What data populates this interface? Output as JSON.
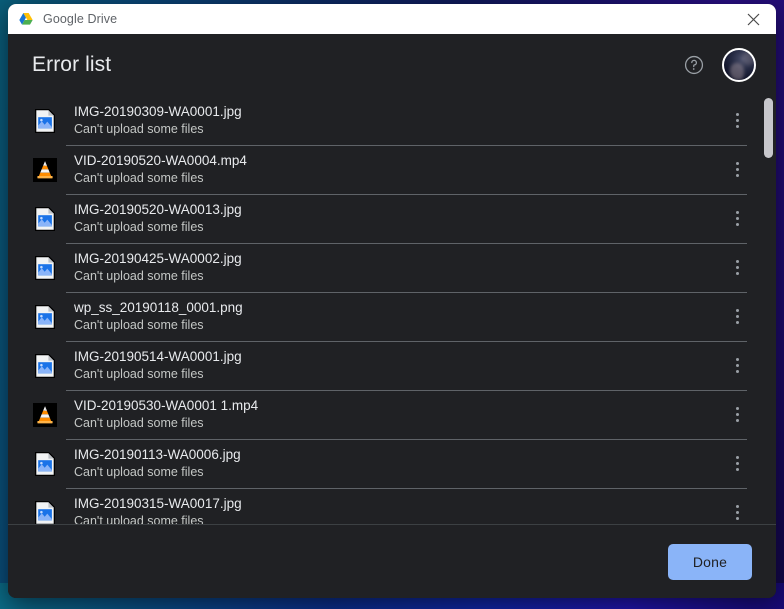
{
  "titlebar": {
    "title": "Google Drive",
    "app_icon": "google-drive-logo",
    "close_icon": "close-icon"
  },
  "header": {
    "title": "Error list",
    "help_icon": "help-circle-icon",
    "avatar_icon": "user-avatar"
  },
  "colors": {
    "window_bg": "#202124",
    "titlebar_bg": "#ffffff",
    "accent": "#8ab4f8",
    "primary_text": "#e8eaed",
    "secondary_text": "#c4c7c5",
    "divider": "#5f6368",
    "scrollbar_thumb": "#c7c7cc"
  },
  "list": {
    "menu_icon": "more-vertical-icon",
    "items": [
      {
        "name": "IMG-20190309-WA0001.jpg",
        "status": "Can't upload some files",
        "icon": "image-file-icon"
      },
      {
        "name": "VID-20190520-WA0004.mp4",
        "status": "Can't upload some files",
        "icon": "vlc-video-file-icon"
      },
      {
        "name": "IMG-20190520-WA0013.jpg",
        "status": "Can't upload some files",
        "icon": "image-file-icon"
      },
      {
        "name": "IMG-20190425-WA0002.jpg",
        "status": "Can't upload some files",
        "icon": "image-file-icon"
      },
      {
        "name": "wp_ss_20190118_0001.png",
        "status": "Can't upload some files",
        "icon": "image-file-icon"
      },
      {
        "name": "IMG-20190514-WA0001.jpg",
        "status": "Can't upload some files",
        "icon": "image-file-icon"
      },
      {
        "name": "VID-20190530-WA0001 1.mp4",
        "status": "Can't upload some files",
        "icon": "vlc-video-file-icon"
      },
      {
        "name": "IMG-20190113-WA0006.jpg",
        "status": "Can't upload some files",
        "icon": "image-file-icon"
      },
      {
        "name": "IMG-20190315-WA0017.jpg",
        "status": "Can't upload some files",
        "icon": "image-file-icon"
      }
    ]
  },
  "footer": {
    "done_label": "Done"
  }
}
